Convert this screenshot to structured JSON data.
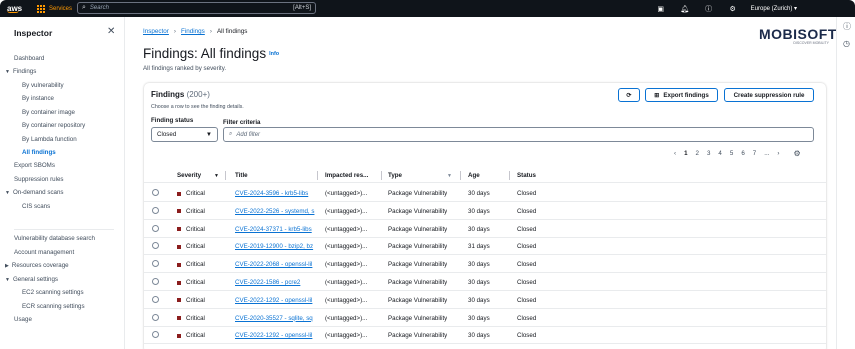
{
  "topbar": {
    "logo": "aws",
    "services": "Services",
    "search_placeholder": "Search",
    "search_shortcut": "[Alt+S]",
    "icons": [
      "terminal-icon",
      "bell-icon",
      "help-icon",
      "settings-icon"
    ],
    "region": "Europe (Zurich) ▾"
  },
  "sidebar": {
    "title": "Inspector",
    "items": [
      {
        "label": "Dashboard"
      },
      {
        "label": "Findings",
        "expanded": true
      },
      {
        "label": "By vulnerability"
      },
      {
        "label": "By instance"
      },
      {
        "label": "By container image"
      },
      {
        "label": "By container repository"
      },
      {
        "label": "By Lambda function"
      },
      {
        "label": "All findings",
        "active": true
      },
      {
        "label": "Export SBOMs"
      },
      {
        "label": "Suppression rules"
      },
      {
        "label": "On-demand scans",
        "expanded": true
      },
      {
        "label": "CIS scans"
      },
      {
        "label": "Vulnerability database search"
      },
      {
        "label": "Account management"
      },
      {
        "label": "Resources coverage",
        "expanded": false
      },
      {
        "label": "General settings",
        "expanded": true
      },
      {
        "label": "EC2 scanning settings"
      },
      {
        "label": "ECR scanning settings"
      },
      {
        "label": "Usage"
      }
    ]
  },
  "breadcrumb": [
    "Inspector",
    "Findings",
    "All findings"
  ],
  "page": {
    "title": "Findings: All findings",
    "info": "Info",
    "subtitle": "All findings ranked by severity."
  },
  "brand": {
    "name": "MOBISOFT",
    "tagline": "DISCOVER MOBILITY"
  },
  "findings_panel": {
    "title": "Findings",
    "count": "(200+)",
    "description": "Choose a row to see the finding details.",
    "refresh_icon": "refresh-icon",
    "export_label": "Export findings",
    "create_rule_label": "Create suppression rule",
    "status_label": "Finding status",
    "status_value": "Closed",
    "filter_label": "Filter criteria",
    "filter_placeholder": "Add filter",
    "pages": [
      "1",
      "2",
      "3",
      "4",
      "5",
      "6",
      "7",
      "..."
    ],
    "current_page": "1",
    "columns": [
      "Severity",
      "Title",
      "Impacted res...",
      "Type",
      "Age",
      "Status"
    ],
    "rows": [
      {
        "severity": "Critical",
        "title": "CVE-2024-3596 - krb5-libs",
        "resource": "(<untagged>)...",
        "type": "Package Vulnerability",
        "age": "30 days",
        "status": "Closed"
      },
      {
        "severity": "Critical",
        "title": "CVE-2022-2526 - systemd, s",
        "resource": "(<untagged>)...",
        "type": "Package Vulnerability",
        "age": "30 days",
        "status": "Closed"
      },
      {
        "severity": "Critical",
        "title": "CVE-2024-37371 - krb5-libs",
        "resource": "(<untagged>)...",
        "type": "Package Vulnerability",
        "age": "30 days",
        "status": "Closed"
      },
      {
        "severity": "Critical",
        "title": "CVE-2019-12900 - bzip2, bz",
        "resource": "(<untagged>)...",
        "type": "Package Vulnerability",
        "age": "31 days",
        "status": "Closed"
      },
      {
        "severity": "Critical",
        "title": "CVE-2022-2068 - openssl-lil",
        "resource": "(<untagged>)...",
        "type": "Package Vulnerability",
        "age": "30 days",
        "status": "Closed"
      },
      {
        "severity": "Critical",
        "title": "CVE-2022-1586 - pcre2",
        "resource": "(<untagged>)...",
        "type": "Package Vulnerability",
        "age": "30 days",
        "status": "Closed"
      },
      {
        "severity": "Critical",
        "title": "CVE-2022-1292 - openssl-lil",
        "resource": "(<untagged>)...",
        "type": "Package Vulnerability",
        "age": "30 days",
        "status": "Closed"
      },
      {
        "severity": "Critical",
        "title": "CVE-2020-35527 - sqlite, sq",
        "resource": "(<untagged>)...",
        "type": "Package Vulnerability",
        "age": "30 days",
        "status": "Closed"
      },
      {
        "severity": "Critical",
        "title": "CVE-2022-1292 - openssl-lil",
        "resource": "(<untagged>)...",
        "type": "Package Vulnerability",
        "age": "30 days",
        "status": "Closed"
      }
    ]
  },
  "colors": {
    "accent": "#0972d3",
    "topbar": "#0f141a",
    "aws_orange": "#ff9900",
    "critical": "#8b1d1d"
  }
}
